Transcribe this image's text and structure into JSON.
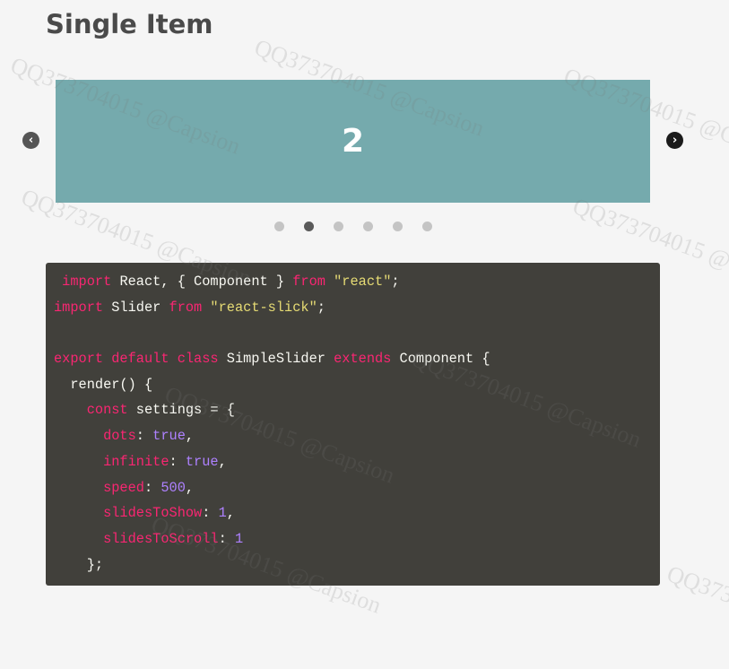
{
  "page": {
    "title": "Single Item"
  },
  "slider": {
    "current_slide": "2",
    "prev_icon": "chevron-left-circle-icon",
    "prev_glyph": "‹",
    "next_icon": "chevron-right-circle-icon",
    "next_glyph": "›",
    "slide_color": "#75aaad",
    "dot_count": 6,
    "active_dot": 2
  },
  "code": {
    "lines": [
      [
        {
          "t": " import",
          "c": "kw"
        },
        {
          "t": " React, { Component } ",
          "c": "pl"
        },
        {
          "t": "from",
          "c": "kw"
        },
        {
          "t": " ",
          "c": "pl"
        },
        {
          "t": "\"react\"",
          "c": "str"
        },
        {
          "t": ";",
          "c": "pl"
        }
      ],
      [
        {
          "t": "import",
          "c": "kw"
        },
        {
          "t": " Slider ",
          "c": "pl"
        },
        {
          "t": "from",
          "c": "kw"
        },
        {
          "t": " ",
          "c": "pl"
        },
        {
          "t": "\"react-slick\"",
          "c": "str"
        },
        {
          "t": ";",
          "c": "pl"
        }
      ],
      [],
      [
        {
          "t": "export default class",
          "c": "kw"
        },
        {
          "t": " SimpleSlider ",
          "c": "pl"
        },
        {
          "t": "extends",
          "c": "kw"
        },
        {
          "t": " Component {",
          "c": "pl"
        }
      ],
      [
        {
          "t": "  render() {",
          "c": "pl"
        }
      ],
      [
        {
          "t": "    ",
          "c": "pl"
        },
        {
          "t": "const",
          "c": "kw"
        },
        {
          "t": " settings = {",
          "c": "pl"
        }
      ],
      [
        {
          "t": "      ",
          "c": "pl"
        },
        {
          "t": "dots",
          "c": "prop"
        },
        {
          "t": ": ",
          "c": "pl"
        },
        {
          "t": "true",
          "c": "num"
        },
        {
          "t": ",",
          "c": "pl"
        }
      ],
      [
        {
          "t": "      ",
          "c": "pl"
        },
        {
          "t": "infinite",
          "c": "prop"
        },
        {
          "t": ": ",
          "c": "pl"
        },
        {
          "t": "true",
          "c": "num"
        },
        {
          "t": ",",
          "c": "pl"
        }
      ],
      [
        {
          "t": "      ",
          "c": "pl"
        },
        {
          "t": "speed",
          "c": "prop"
        },
        {
          "t": ": ",
          "c": "pl"
        },
        {
          "t": "500",
          "c": "num"
        },
        {
          "t": ",",
          "c": "pl"
        }
      ],
      [
        {
          "t": "      ",
          "c": "pl"
        },
        {
          "t": "slidesToShow",
          "c": "prop"
        },
        {
          "t": ": ",
          "c": "pl"
        },
        {
          "t": "1",
          "c": "num"
        },
        {
          "t": ",",
          "c": "pl"
        }
      ],
      [
        {
          "t": "      ",
          "c": "pl"
        },
        {
          "t": "slidesToScroll",
          "c": "prop"
        },
        {
          "t": ": ",
          "c": "pl"
        },
        {
          "t": "1",
          "c": "num"
        }
      ],
      [
        {
          "t": "    };",
          "c": "pl"
        }
      ]
    ]
  },
  "watermark": "QQ373704015 @Capsion"
}
